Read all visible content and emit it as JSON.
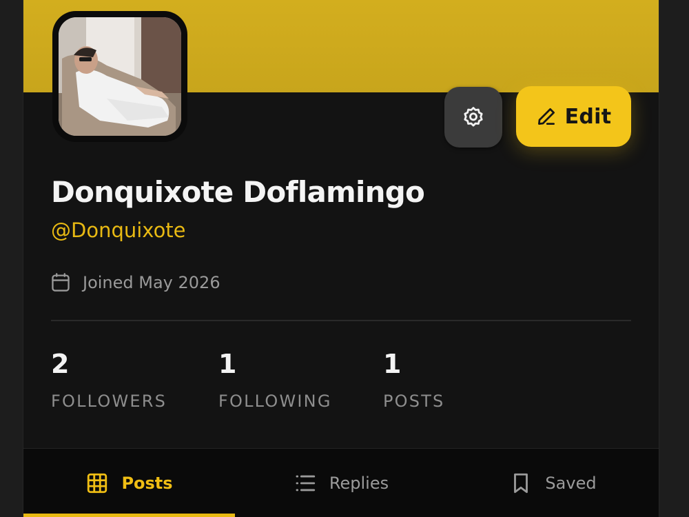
{
  "profile": {
    "name": "Donquixote Doflamingo",
    "handle": "@Donquixote",
    "joined": "Joined May 2026"
  },
  "actions": {
    "settings_icon": "settings-gear-icon",
    "edit_label": "Edit",
    "edit_icon": "pencil-icon"
  },
  "stats": [
    {
      "value": "2",
      "label": "FOLLOWERS"
    },
    {
      "value": "1",
      "label": "FOLLOWING"
    },
    {
      "value": "1",
      "label": "POSTS"
    }
  ],
  "tabs": [
    {
      "label": "Posts",
      "icon": "grid-icon",
      "active": true
    },
    {
      "label": "Replies",
      "icon": "list-icon",
      "active": false
    },
    {
      "label": "Saved",
      "icon": "bookmark-icon",
      "active": false
    }
  ],
  "colors": {
    "accent": "#f3c51a",
    "banner": "#cfaa1d",
    "background": "#131313",
    "handle": "#e8b913"
  }
}
